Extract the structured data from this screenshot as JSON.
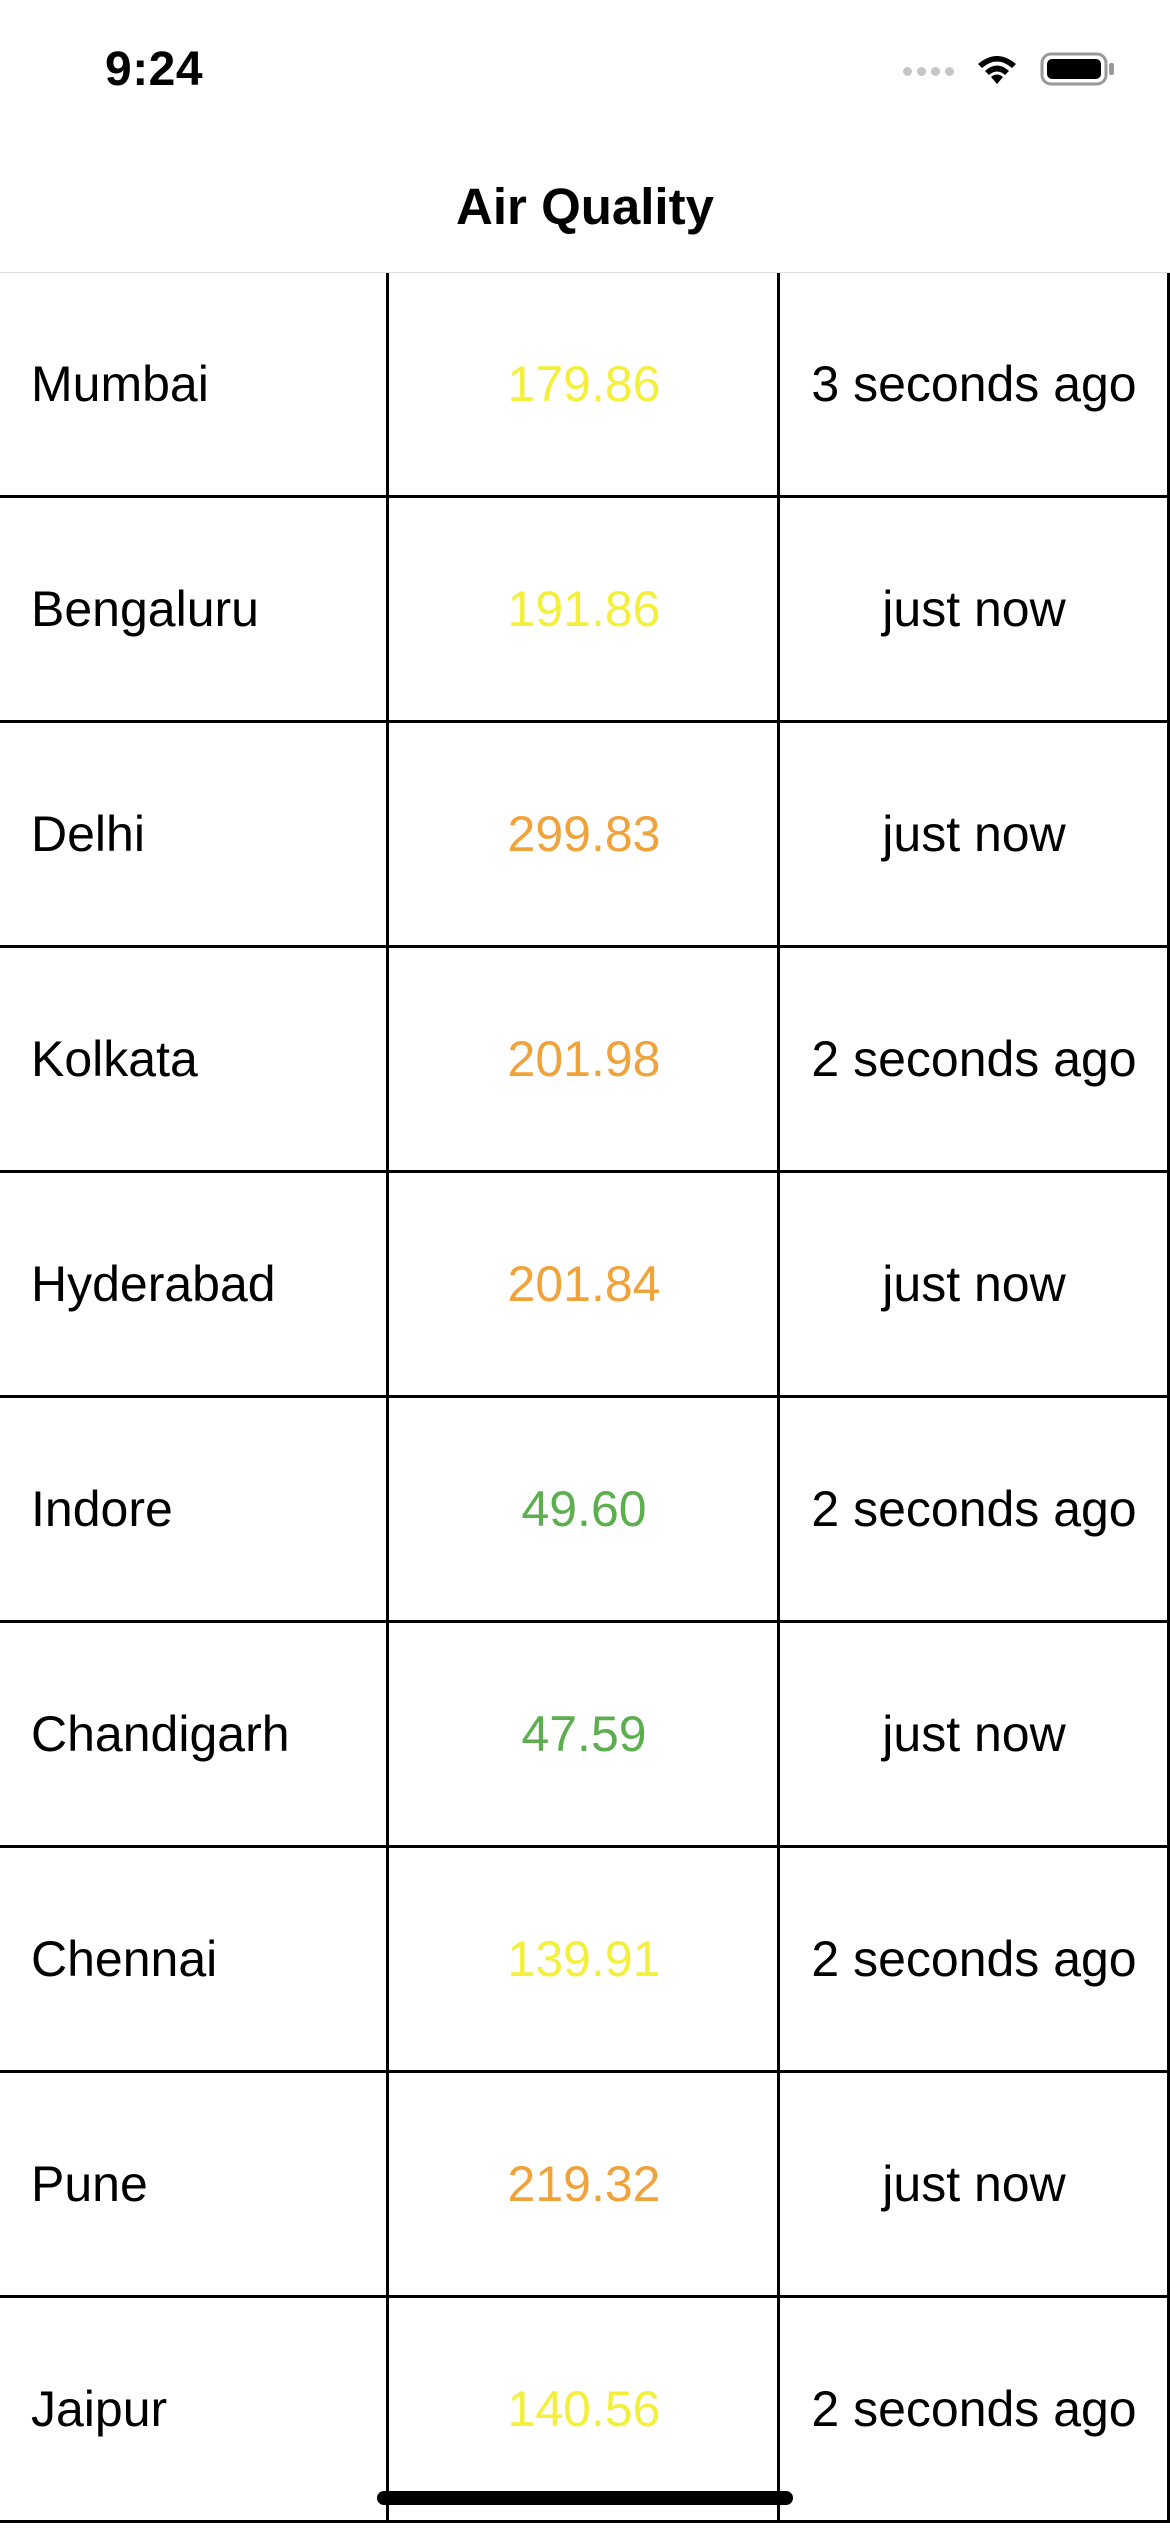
{
  "status_bar": {
    "time": "9:24"
  },
  "nav": {
    "title": "Air Quality"
  },
  "colors": {
    "good": "#5cae4f",
    "moderate": "#f3ef3a",
    "poor": "#f0a23b",
    "divider": "#000000"
  },
  "rows": [
    {
      "city": "Mumbai",
      "aqi": "179.86",
      "level": "moderate",
      "updated": "3 seconds ago"
    },
    {
      "city": "Bengaluru",
      "aqi": "191.86",
      "level": "moderate",
      "updated": "just now"
    },
    {
      "city": "Delhi",
      "aqi": "299.83",
      "level": "poor",
      "updated": "just now"
    },
    {
      "city": "Kolkata",
      "aqi": "201.98",
      "level": "poor",
      "updated": "2 seconds ago"
    },
    {
      "city": "Hyderabad",
      "aqi": "201.84",
      "level": "poor",
      "updated": "just now"
    },
    {
      "city": "Indore",
      "aqi": "49.60",
      "level": "good",
      "updated": "2 seconds ago"
    },
    {
      "city": "Chandigarh",
      "aqi": "47.59",
      "level": "good",
      "updated": "just now"
    },
    {
      "city": "Chennai",
      "aqi": "139.91",
      "level": "moderate",
      "updated": "2 seconds ago"
    },
    {
      "city": "Pune",
      "aqi": "219.32",
      "level": "poor",
      "updated": "just now"
    },
    {
      "city": "Jaipur",
      "aqi": "140.56",
      "level": "moderate",
      "updated": "2 seconds ago"
    }
  ]
}
